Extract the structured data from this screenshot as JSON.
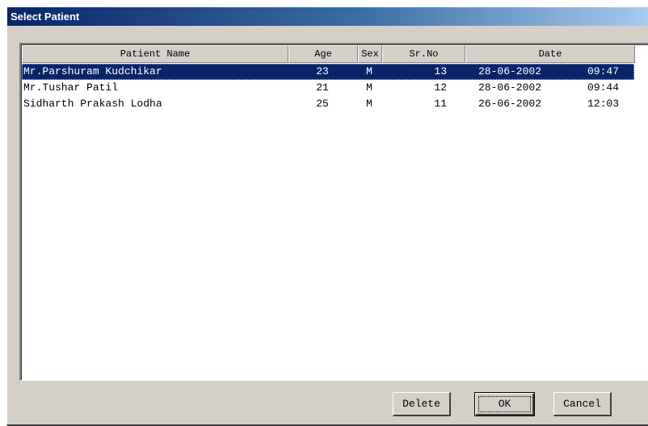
{
  "window": {
    "title": "Select Patient"
  },
  "columns": {
    "name": "Patient Name",
    "age": "Age",
    "sex": "Sex",
    "srno": "Sr.No",
    "date": "Date"
  },
  "patients": [
    {
      "name": "Mr.Parshuram Kudchikar",
      "age": "23",
      "sex": "M",
      "srno": "13",
      "date": "28-06-2002",
      "time": "09:47",
      "selected": true
    },
    {
      "name": "Mr.Tushar Patil",
      "age": "21",
      "sex": "M",
      "srno": "12",
      "date": "28-06-2002",
      "time": "09:44",
      "selected": false
    },
    {
      "name": "Sidharth Prakash Lodha",
      "age": "25",
      "sex": "M",
      "srno": "11",
      "date": "26-06-2002",
      "time": "12:03",
      "selected": false
    }
  ],
  "buttons": {
    "delete": "Delete",
    "ok": "OK",
    "cancel": "Cancel"
  },
  "colors": {
    "selection": "#0a246a",
    "face": "#d4d0c8",
    "titlebar_start": "#0a246a",
    "titlebar_end": "#a6caf0"
  }
}
